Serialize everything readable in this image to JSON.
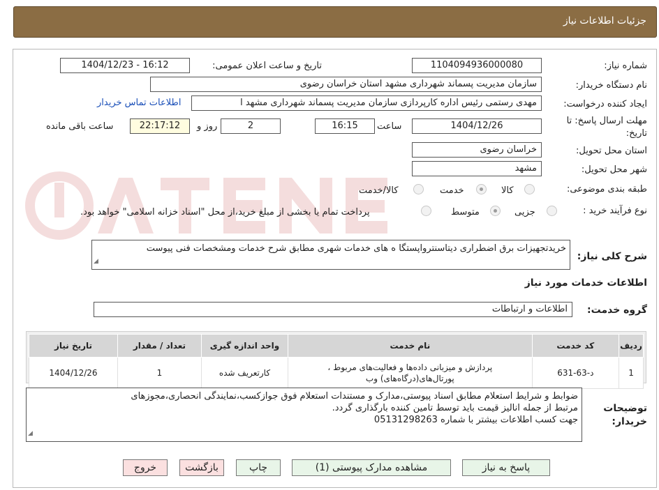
{
  "header": {
    "title": "جزئیات اطلاعات نیاز"
  },
  "form": {
    "need_number_label": "شماره نیاز:",
    "need_number": "1104094936000080",
    "announce_label": "تاریخ و ساعت اعلان عمومی:",
    "announce_value": "1404/12/23 - 16:12",
    "buyer_org_label": "نام دستگاه خریدار:",
    "buyer_org": "سازمان مدیریت پسماند شهرداری مشهد استان خراسان رضوی",
    "requester_label": "ایجاد کننده درخواست:",
    "requester": "مهدی رستمی رئیس اداره کارپردازی سازمان مدیریت پسماند شهرداری مشهد ا",
    "contact_link": "اطلاعات تماس خریدار",
    "deadline_label_1": "مهلت ارسال پاسخ: تا",
    "deadline_label_2": "تاریخ:",
    "deadline_date": "1404/12/26",
    "time_label": "ساعت",
    "deadline_time": "16:15",
    "days_value": "2",
    "days_label": "روز و",
    "remaining_time": "22:17:12",
    "remaining_label": "ساعت باقی مانده",
    "province_label": "استان محل تحویل:",
    "province": "خراسان رضوی",
    "city_label": "شهر محل تحویل:",
    "city": "مشهد",
    "category_label": "طبقه بندی موضوعی:",
    "category_options": [
      "کالا",
      "خدمت",
      "کالا/خدمت"
    ],
    "category_selected": "خدمت",
    "process_label": "نوع فرآیند خرید :",
    "process_options": [
      "جزیی",
      "متوسط"
    ],
    "process_selected": "متوسط",
    "process_note": "پرداخت تمام یا بخشی از مبلغ خرید،از محل \"اسناد خزانه اسلامی\" خواهد بود.",
    "summary_label": "شرح کلی نیاز:",
    "summary": "خریدتجهیزات برق اضطراری دیتاسنترواپستگا ه های خدمات شهری مطابق شرح خدمات ومشخصات فنی پیوست",
    "services_heading": "اطلاعات خدمات مورد نیاز",
    "service_group_label": "گروه خدمت:",
    "service_group": "اطلاعات و ارتباطات"
  },
  "table": {
    "headers": [
      "ردیف",
      "کد خدمت",
      "نام خدمت",
      "واحد اندازه گیری",
      "تعداد / مقدار",
      "تاریخ نیاز"
    ],
    "rows": [
      {
        "row": "1",
        "code": "د-63-631",
        "name": "پردازش و میزبانی داده‌ها و فعالیت‌های مربوط ، پورتال‌های(درگاه‌های) وب",
        "unit": "کارتعریف شده",
        "qty": "1",
        "date": "1404/12/26"
      }
    ]
  },
  "notes": {
    "label_1": "توضیحات",
    "label_2": "خریدار:",
    "line_1": "ضوابط و شرایط استعلام مطابق اسناد پیوستی،مدارک و مستندات استعلام فوق جوازکسب،نمایندگی انحصاری،مجوزهای",
    "line_2": "مرتبط از جمله انالیز قیمت باید توسط تامین کننده بارگذاری گردد.",
    "line_3": "جهت کسب اطلاعات بیشتر با شماره 05131298263"
  },
  "buttons": {
    "reply": "پاسخ به نیاز",
    "attachments": "مشاهده مدارک پیوستی (1)",
    "print": "چاپ",
    "back": "بازگشت",
    "exit": "خروج"
  },
  "colors": {
    "header_bg": "#8b6d44",
    "link": "#1a4fb8",
    "button_bg": "#e8f5e8",
    "button_red_bg": "#fbe0e0"
  }
}
